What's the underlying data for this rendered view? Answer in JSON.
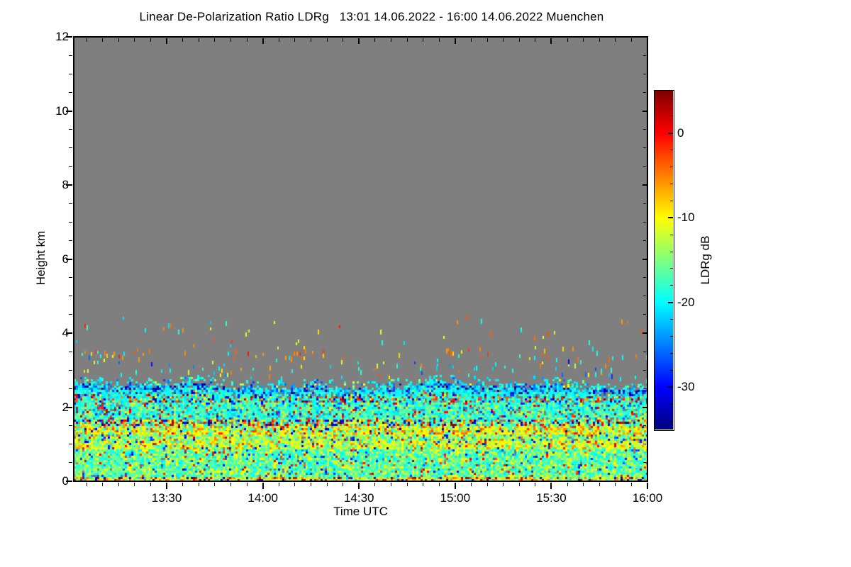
{
  "colors": {
    "page_background": "#ffffff",
    "no_data_gray": "#7f7f7f",
    "frame": "#000000",
    "text": "#000000"
  },
  "chart_data": {
    "type": "heatmap",
    "title": "Linear De-Polarization Ratio LDRg   13:01 14.06.2022 - 16:00 14.06.2022 Muenchen",
    "xlabel": "Time UTC",
    "ylabel": "Height km",
    "x_start": "13:01",
    "x_end": "16:00",
    "x_major_ticks": [
      "13:30",
      "14:00",
      "14:30",
      "15:00",
      "15:30",
      "16:00"
    ],
    "x_minor_step_min": 5,
    "y_range_km": [
      0,
      12
    ],
    "y_major_ticks_km": [
      0,
      2,
      4,
      6,
      8,
      10,
      12
    ],
    "y_minor_step_km": 0.5,
    "grid": false,
    "no_data_color": "#7f7f7f",
    "colorbar": {
      "label": "LDRg dB",
      "colormap": "jet",
      "max_db": 5,
      "min_db": -35,
      "major_ticks_db": [
        0,
        -10,
        -20,
        -30
      ],
      "minor_step_db": 2
    },
    "layers": [
      {
        "height_km": [
          0.0,
          0.12
        ],
        "fill": 1.0,
        "hole": 0.0,
        "components": [
          {
            "w": 0.4,
            "db": -10,
            "j": 2.0
          },
          {
            "w": 0.22,
            "db": -15,
            "j": 2.0
          },
          {
            "w": 0.14,
            "db": -5,
            "j": 1.5
          },
          {
            "w": 0.1,
            "db": 2,
            "j": 2.0
          },
          {
            "w": 0.07,
            "db": -32,
            "j": 2.0
          },
          {
            "w": 0.07,
            "db": -20,
            "j": 1.5
          }
        ],
        "note": "near-surface: yellow-orange with dark red and navy clutter specks"
      },
      {
        "height_km": [
          0.12,
          0.85
        ],
        "fill": 0.99,
        "hole": 0.015,
        "components": [
          {
            "w": 0.42,
            "db": -16,
            "j": 2.0
          },
          {
            "w": 0.28,
            "db": -19.5,
            "j": 1.5
          },
          {
            "w": 0.22,
            "db": -11,
            "j": 1.5
          },
          {
            "w": 0.04,
            "db": -27,
            "j": 3.0
          },
          {
            "w": 0.04,
            "db": -1,
            "j": 3.0
          }
        ],
        "note": "boundary layer: green-cyan mix with yellow"
      },
      {
        "height_km": [
          0.85,
          1.1
        ],
        "fill": 0.99,
        "hole": 0.01,
        "components": [
          {
            "w": 0.46,
            "db": -10.5,
            "j": 1.5
          },
          {
            "w": 0.28,
            "db": -15,
            "j": 2.0
          },
          {
            "w": 0.1,
            "db": -19,
            "j": 1.5
          },
          {
            "w": 0.09,
            "db": -6,
            "j": 1.5
          },
          {
            "w": 0.04,
            "db": -30,
            "j": 3.0
          },
          {
            "w": 0.03,
            "db": 0,
            "j": 2.0
          }
        ],
        "note": "yellow band near 1 km"
      },
      {
        "height_km": [
          1.1,
          1.28
        ],
        "fill": 0.97,
        "hole": 0.05,
        "hole_bias_right": true,
        "components": [
          {
            "w": 0.38,
            "db": -15,
            "j": 2.0
          },
          {
            "w": 0.32,
            "db": -11,
            "j": 1.5
          },
          {
            "w": 0.16,
            "db": -19,
            "j": 1.5
          },
          {
            "w": 0.06,
            "db": -6,
            "j": 2.0
          },
          {
            "w": 0.05,
            "db": -28,
            "j": 3.0
          },
          {
            "w": 0.03,
            "db": 1,
            "j": 2.0
          }
        ],
        "note": "green-yellow mix"
      },
      {
        "height_km": [
          1.28,
          1.5
        ],
        "fill": 0.99,
        "hole": 0.01,
        "components": [
          {
            "w": 0.42,
            "db": -10,
            "j": 1.5
          },
          {
            "w": 0.16,
            "db": -5.5,
            "j": 1.5
          },
          {
            "w": 0.24,
            "db": -15,
            "j": 2.0
          },
          {
            "w": 0.06,
            "db": -1.5,
            "j": 1.8
          },
          {
            "w": 0.08,
            "db": -19,
            "j": 1.5
          },
          {
            "w": 0.04,
            "db": -31,
            "j": 2.0
          }
        ],
        "note": "strong yellow band with orange specks near 1.4 km"
      },
      {
        "height_km": [
          1.5,
          1.65
        ],
        "fill": 0.97,
        "hole": 0.05,
        "components": [
          {
            "w": 0.27,
            "db": -16,
            "j": 2.0
          },
          {
            "w": 0.18,
            "db": -11,
            "j": 2.0
          },
          {
            "w": 0.15,
            "db": 1.5,
            "j": 2.5
          },
          {
            "w": 0.12,
            "db": -32,
            "j": 2.0
          },
          {
            "w": 0.16,
            "db": -20,
            "j": 1.5
          },
          {
            "w": 0.12,
            "db": -5,
            "j": 2.0
          }
        ],
        "note": "dark speckled line near 1.6 km"
      },
      {
        "height_km": [
          1.65,
          2.1
        ],
        "fill": 0.97,
        "hole": 0.05,
        "components": [
          {
            "w": 0.43,
            "db": -16.5,
            "j": 1.8
          },
          {
            "w": 0.34,
            "db": -20,
            "j": 1.5
          },
          {
            "w": 0.1,
            "db": -12,
            "j": 1.5
          },
          {
            "w": 0.08,
            "db": -27,
            "j": 3.0
          },
          {
            "w": 0.05,
            "db": 0,
            "j": 2.5
          }
        ],
        "note": "green-cyan with scattered dark blue"
      },
      {
        "height_km": [
          2.1,
          2.28
        ],
        "fill": 0.95,
        "hole": 0.08,
        "hole_bias_right": true,
        "components": [
          {
            "w": 0.42,
            "db": -20,
            "j": 1.5
          },
          {
            "w": 0.22,
            "db": -17,
            "j": 1.5
          },
          {
            "w": 0.11,
            "db": 1,
            "j": 3.0
          },
          {
            "w": 0.08,
            "db": -5,
            "j": 2.0
          },
          {
            "w": 0.09,
            "db": -31,
            "j": 2.0
          },
          {
            "w": 0.08,
            "db": -12,
            "j": 2.0
          }
        ],
        "note": "brown-speckled line near 2.2 km"
      },
      {
        "height_km": [
          2.28,
          2.42
        ],
        "fill": 0.96,
        "hole": 0.03,
        "components": [
          {
            "w": 0.58,
            "db": -20,
            "j": 1.3
          },
          {
            "w": 0.2,
            "db": -17.5,
            "j": 1.5
          },
          {
            "w": 0.13,
            "db": -26,
            "j": 2.5
          },
          {
            "w": 0.05,
            "db": -13,
            "j": 2.0
          },
          {
            "w": 0.04,
            "db": -32,
            "j": 2.0
          }
        ],
        "note": "cyan band"
      },
      {
        "height_km": [
          2.42,
          2.55
        ],
        "fill": 0.9,
        "hole": 0.05,
        "components": [
          {
            "w": 0.48,
            "db": -20.5,
            "j": 1.3
          },
          {
            "w": 0.26,
            "db": -26,
            "j": 3.0
          },
          {
            "w": 0.16,
            "db": -33,
            "j": 1.5
          },
          {
            "w": 0.1,
            "db": -18,
            "j": 1.5
          }
        ],
        "note": "cloud-top cyan with navy specks"
      },
      {
        "height_km": [
          2.55,
          2.8
        ],
        "fill": 0.45,
        "hole": 0.0,
        "fade_up": true,
        "components": [
          {
            "w": 0.58,
            "db": -20,
            "j": 1.5
          },
          {
            "w": 0.2,
            "db": -26,
            "j": 3.0
          },
          {
            "w": 0.12,
            "db": -12,
            "j": 2.0
          },
          {
            "w": 0.1,
            "db": -17,
            "j": 2.0
          }
        ],
        "note": "ragged top edge, cyan streaks thinning into gray"
      },
      {
        "height_km": [
          2.8,
          3.3
        ],
        "fill": 0.06,
        "hole": 0.0,
        "fade_up": true,
        "components": [
          {
            "w": 0.48,
            "db": -20,
            "j": 2.0
          },
          {
            "w": 0.25,
            "db": -11,
            "j": 2.0
          },
          {
            "w": 0.15,
            "db": -27,
            "j": 3.0
          },
          {
            "w": 0.12,
            "db": -5,
            "j": 2.0
          }
        ],
        "note": "sparse specks above cloud top"
      },
      {
        "height_km": [
          3.3,
          3.5
        ],
        "fill": 0.11,
        "hole": 0.0,
        "x_patchy": true,
        "components": [
          {
            "w": 0.52,
            "db": -5,
            "j": 1.5
          },
          {
            "w": 0.2,
            "db": -2,
            "j": 1.5
          },
          {
            "w": 0.16,
            "db": -9,
            "j": 1.5
          },
          {
            "w": 0.12,
            "db": -20,
            "j": 2.0
          }
        ],
        "note": "patchy orange aerosol layer near 3.4 km"
      },
      {
        "height_km": [
          3.5,
          4.45
        ],
        "fill": 0.012,
        "hole": 0.0,
        "components": [
          {
            "w": 0.4,
            "db": -10,
            "j": 2.0
          },
          {
            "w": 0.25,
            "db": -5,
            "j": 2.0
          },
          {
            "w": 0.25,
            "db": -20,
            "j": 2.0
          },
          {
            "w": 0.1,
            "db": -1,
            "j": 2.0
          }
        ],
        "note": "very sparse isolated dots"
      },
      {
        "height_km": [
          4.45,
          12.0
        ],
        "fill": 0.0,
        "hole": 0.0,
        "components": [],
        "note": "no data (gray)"
      }
    ]
  }
}
